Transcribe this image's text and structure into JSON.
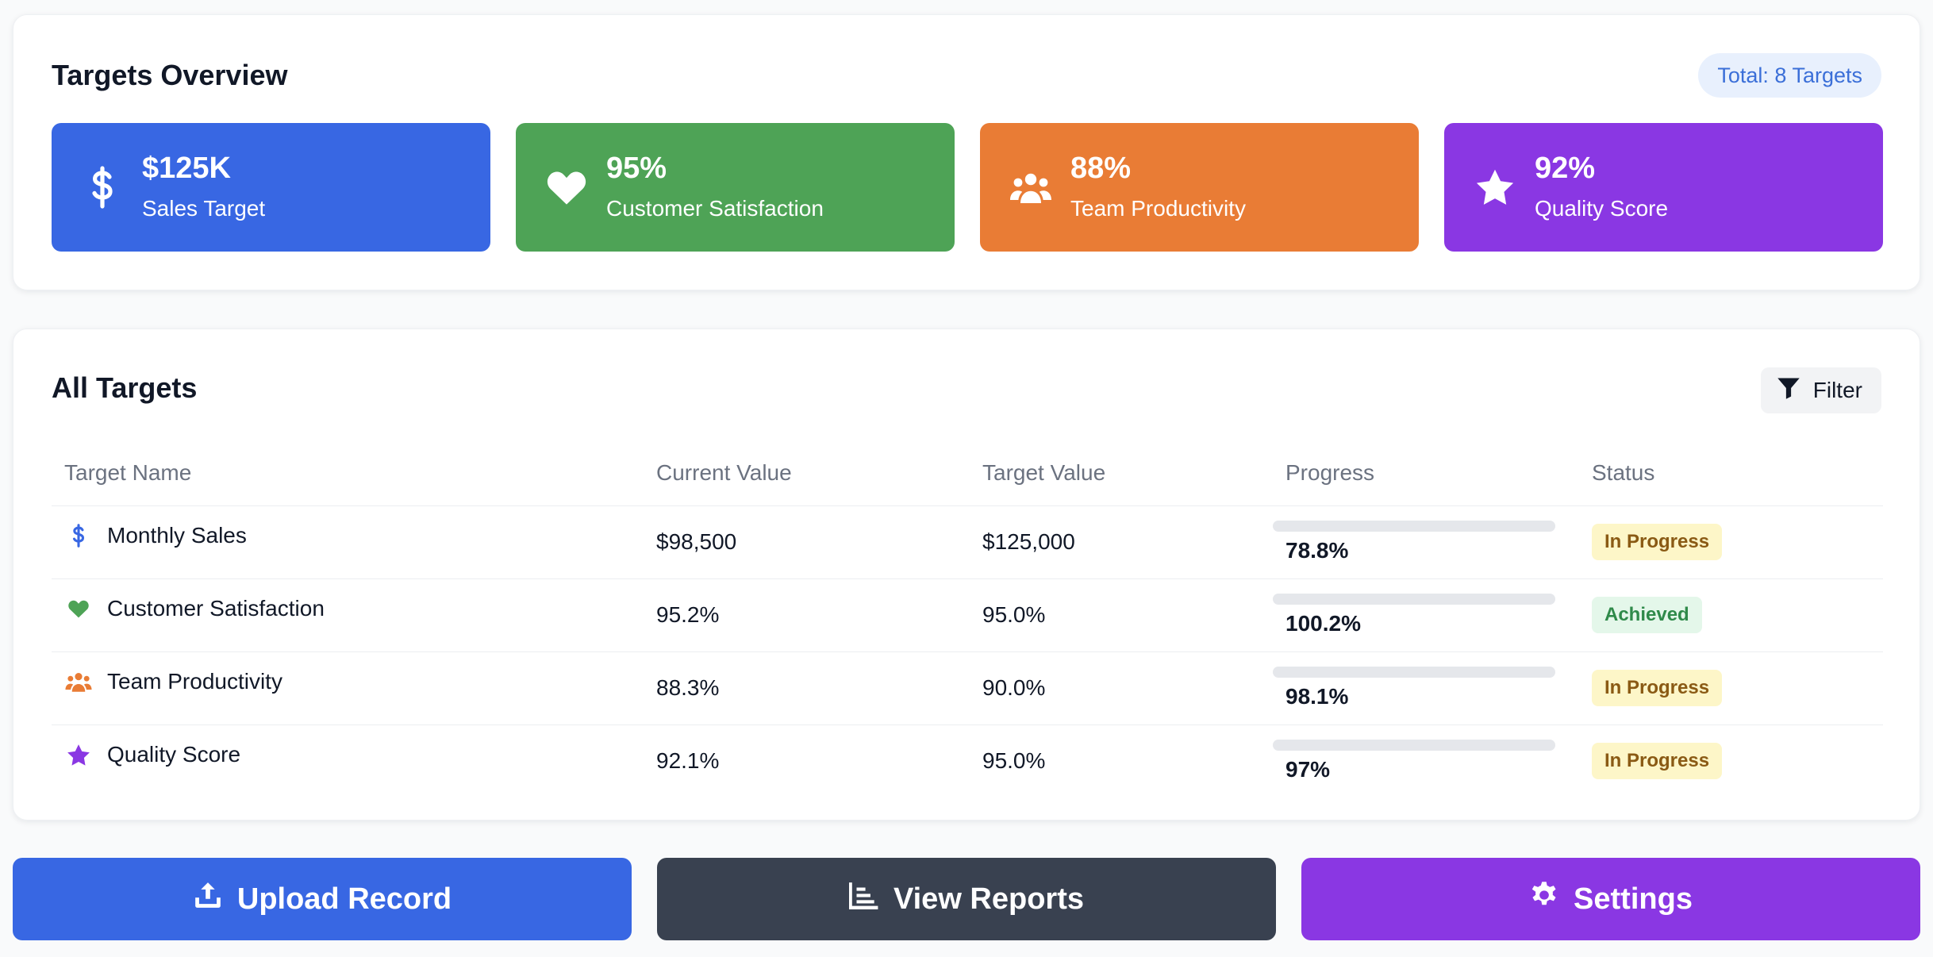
{
  "overview": {
    "title": "Targets Overview",
    "total_label": "Total: 8 Targets",
    "stats": [
      {
        "value": "$125K",
        "label": "Sales Target",
        "icon": "dollar-icon",
        "color": "#3867e3"
      },
      {
        "value": "95%",
        "label": "Customer Satisfaction",
        "icon": "heart-icon",
        "color": "#4ea356"
      },
      {
        "value": "88%",
        "label": "Team Productivity",
        "icon": "users-icon",
        "color": "#e97c35"
      },
      {
        "value": "92%",
        "label": "Quality Score",
        "icon": "star-icon",
        "color": "#8a37e3"
      }
    ]
  },
  "targets": {
    "title": "All Targets",
    "filter_label": "Filter",
    "columns": [
      "Target Name",
      "Current Value",
      "Target Value",
      "Progress",
      "Status"
    ],
    "rows": [
      {
        "name": "Monthly Sales",
        "icon": "dollar-icon",
        "icon_color": "#3867e3",
        "current": "$98,500",
        "target": "$125,000",
        "progress_label": "78.8%",
        "status": "In Progress",
        "status_type": "progress"
      },
      {
        "name": "Customer Satisfaction",
        "icon": "heart-icon",
        "icon_color": "#4ea356",
        "current": "95.2%",
        "target": "95.0%",
        "progress_label": "100.2%",
        "status": "Achieved",
        "status_type": "achieved"
      },
      {
        "name": "Team Productivity",
        "icon": "users-icon",
        "icon_color": "#e97c35",
        "current": "88.3%",
        "target": "90.0%",
        "progress_label": "98.1%",
        "status": "In Progress",
        "status_type": "progress"
      },
      {
        "name": "Quality Score",
        "icon": "star-icon",
        "icon_color": "#8a37e3",
        "current": "92.1%",
        "target": "95.0%",
        "progress_label": "97%",
        "status": "In Progress",
        "status_type": "progress"
      }
    ]
  },
  "actions": [
    {
      "label": "Upload Record",
      "icon": "upload-icon",
      "color": "#3867e3"
    },
    {
      "label": "View Reports",
      "icon": "chart-icon",
      "color": "#394150"
    },
    {
      "label": "Settings",
      "icon": "gear-icon",
      "color": "#8a37e3"
    }
  ]
}
